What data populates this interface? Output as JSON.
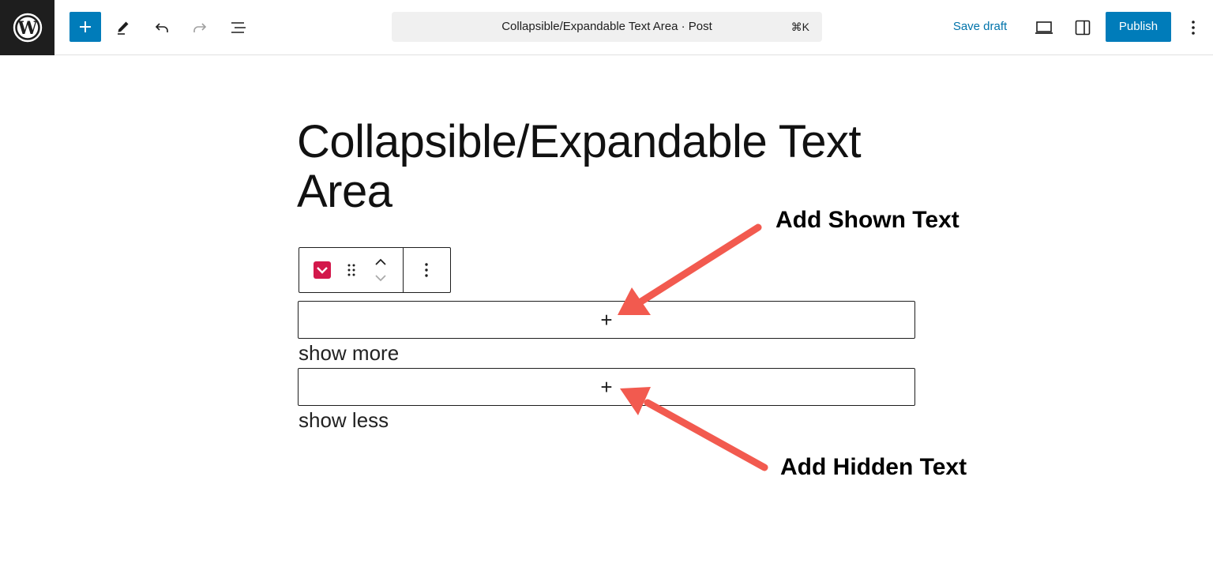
{
  "header": {
    "document_title": "Collapsible/Expandable Text Area · Post",
    "shortcut": "⌘K",
    "save_draft_label": "Save draft",
    "publish_label": "Publish"
  },
  "post": {
    "title": "Collapsible/Expandable Text Area"
  },
  "block": {
    "show_more_label": "show more",
    "show_less_label": "show less",
    "appender_symbol": "+"
  },
  "annotations": {
    "shown_text": "Add Shown Text",
    "hidden_text": "Add Hidden Text"
  },
  "colors": {
    "accent": "#007cba",
    "block_icon": "#d3184b",
    "annotation_arrow": "#f25a4f"
  }
}
